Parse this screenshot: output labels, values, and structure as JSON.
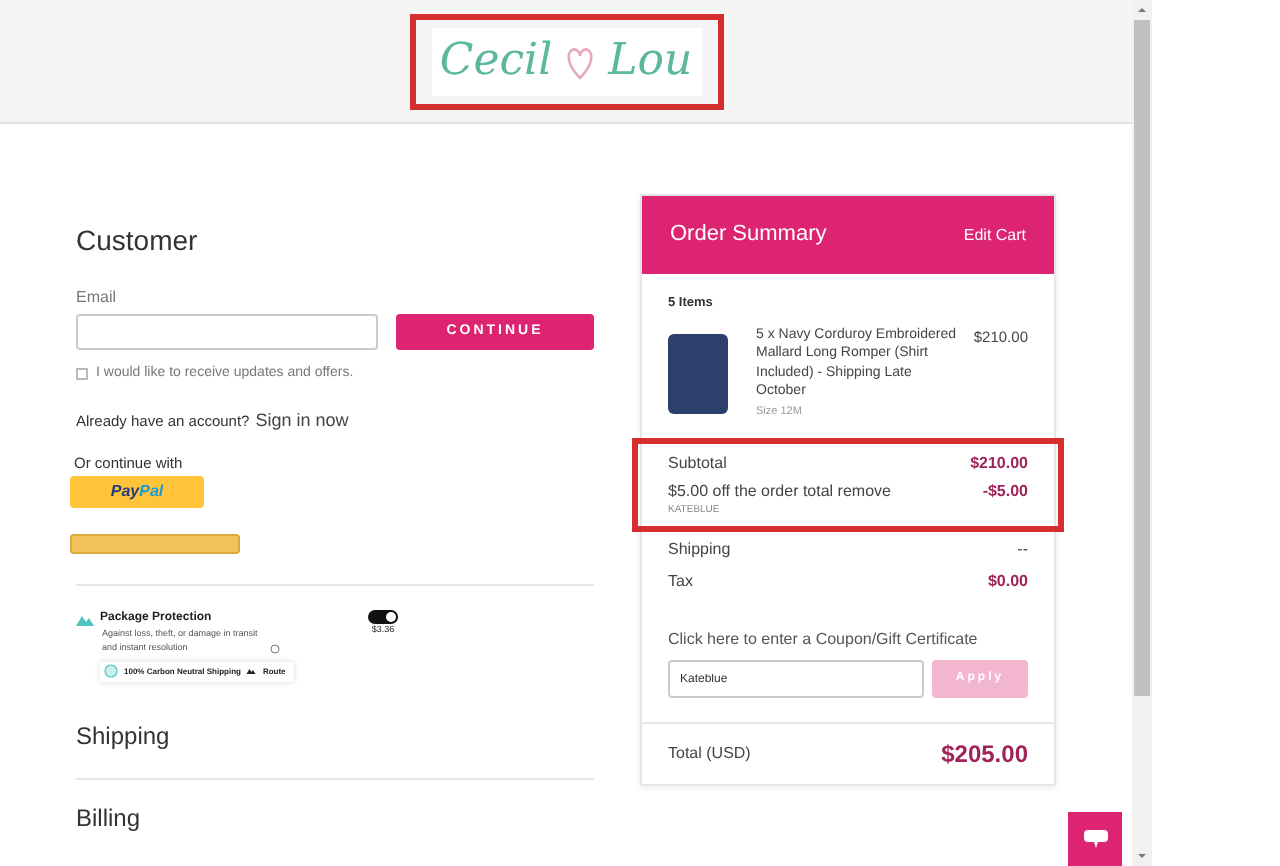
{
  "logo": {
    "first": "Cecil",
    "second": "Lou"
  },
  "customer": {
    "title": "Customer",
    "email_label": "Email",
    "continue": "CONTINUE",
    "updates_label": "I would like to receive updates and offers.",
    "updates_checked": false,
    "account_text": "Already have an account?",
    "sign_in": "Sign in now",
    "continue_with": "Or continue with",
    "paypal_first": "Pay",
    "paypal_second": "Pal"
  },
  "protection": {
    "title": "Package Protection",
    "description": "Against loss, theft, or damage in transit and instant resolution",
    "on": true,
    "price": "$3.36",
    "carbon": "100% Carbon Neutral Shipping",
    "brand": "Route"
  },
  "sections": [
    "Shipping",
    "Billing"
  ],
  "summary": {
    "title": "Order Summary",
    "edit": "Edit Cart",
    "count": "5 Items",
    "items": [
      {
        "name": "5 x Navy Corduroy Embroidered Mallard Long Romper (Shirt Included) - Shipping Late October",
        "size": "Size 12M",
        "price": "$210.00"
      }
    ],
    "subtotal_label": "Subtotal",
    "subtotal": "$210.00",
    "discount_label": "$5.00 off the order total remove",
    "discount": "-$5.00",
    "code": "KATEBLUE",
    "shipping_label": "Shipping",
    "shipping": "--",
    "tax_label": "Tax",
    "tax": "$0.00",
    "coupon_link": "Click here to enter a Coupon/Gift Certificate",
    "coupon_value": "Kateblue",
    "apply": "Apply",
    "apply_disabled": true,
    "total_label": "Total (USD)",
    "total": "$205.00"
  }
}
